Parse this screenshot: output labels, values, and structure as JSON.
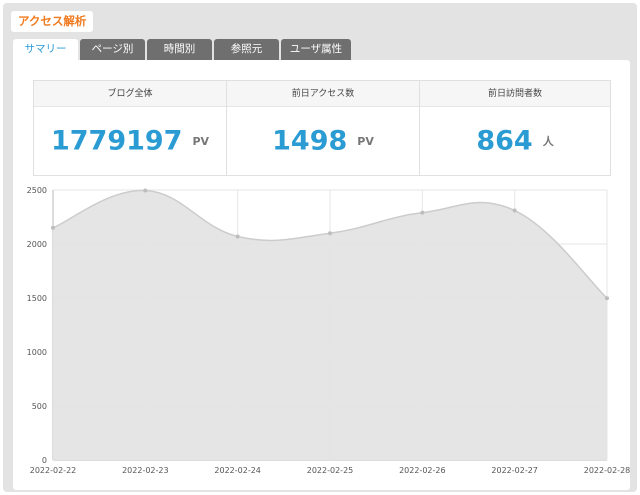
{
  "page": {
    "title": "アクセス解析"
  },
  "tabs": [
    {
      "label": "サマリー",
      "active": true
    },
    {
      "label": "ページ別",
      "active": false
    },
    {
      "label": "時間別",
      "active": false
    },
    {
      "label": "参照元",
      "active": false
    },
    {
      "label": "ユーザ属性",
      "active": false
    }
  ],
  "stats": [
    {
      "label": "ブログ全体",
      "value": "1779197",
      "unit": "PV"
    },
    {
      "label": "前日アクセス数",
      "value": "1498",
      "unit": "PV"
    },
    {
      "label": "前日訪問者数",
      "value": "864",
      "unit": "人"
    }
  ],
  "colors": {
    "accent": "#2a9bd3",
    "title": "#f07b1f",
    "tab": "#6f6f6f",
    "area_fill": "#e4e4e4",
    "line": "#cccccc"
  },
  "chart_data": {
    "type": "area",
    "title": "",
    "xlabel": "",
    "ylabel": "",
    "x": [
      "2022-02-22",
      "2022-02-23",
      "2022-02-24",
      "2022-02-25",
      "2022-02-26",
      "2022-02-27",
      "2022-02-28"
    ],
    "series": [
      {
        "values": [
          2150,
          2495,
          2070,
          2100,
          2290,
          2310,
          1498
        ]
      }
    ],
    "ylim": [
      0,
      2500
    ],
    "yticks": [
      0,
      500,
      1000,
      1500,
      2000,
      2500
    ],
    "grid": true,
    "smooth": true
  }
}
